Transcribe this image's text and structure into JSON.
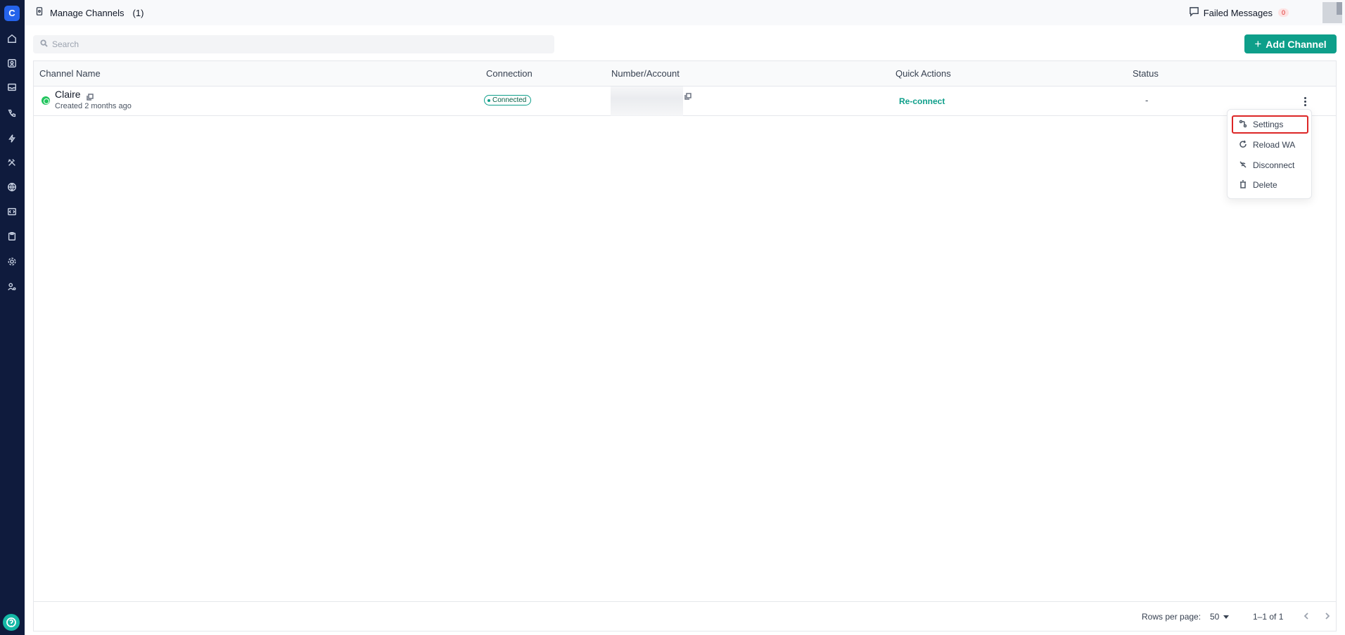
{
  "app": {
    "logo_letter": "C"
  },
  "sidebar": {
    "items": [
      {
        "icon": "home-icon"
      },
      {
        "icon": "contacts-icon"
      },
      {
        "icon": "inbox-icon"
      },
      {
        "icon": "phone-icon"
      },
      {
        "icon": "lightning-icon"
      },
      {
        "icon": "tools-icon"
      },
      {
        "icon": "globe-icon"
      },
      {
        "icon": "code-icon"
      },
      {
        "icon": "clipboard-icon"
      },
      {
        "icon": "settings-icon"
      },
      {
        "icon": "user-settings-icon"
      }
    ],
    "help_icon": "help-icon"
  },
  "header": {
    "title": "Manage Channels",
    "count": "(1)",
    "failed_label": "Failed Messages",
    "failed_count": "0"
  },
  "search": {
    "placeholder": "Search"
  },
  "toolbar": {
    "add_label": "Add Channel"
  },
  "table": {
    "columns": [
      "Channel Name",
      "Connection",
      "Number/Account",
      "Quick Actions",
      "Status"
    ],
    "rows": [
      {
        "name": "Claire",
        "created": "Created 2 months ago",
        "connection": "Connected",
        "quick_action": "Re-connect",
        "status": "-"
      }
    ]
  },
  "menu": {
    "items": [
      {
        "label": "Settings",
        "icon": "settings-flow-icon"
      },
      {
        "label": "Reload WA",
        "icon": "reload-icon"
      },
      {
        "label": "Disconnect",
        "icon": "disconnect-icon"
      },
      {
        "label": "Delete",
        "icon": "trash-icon"
      }
    ]
  },
  "footer": {
    "rows_label": "Rows per page:",
    "rows_value": "50",
    "page_info": "1–1 of 1"
  },
  "colors": {
    "accent": "#0e9f8a",
    "sidebar": "#0f1b3d",
    "highlight": "#dc2626"
  }
}
